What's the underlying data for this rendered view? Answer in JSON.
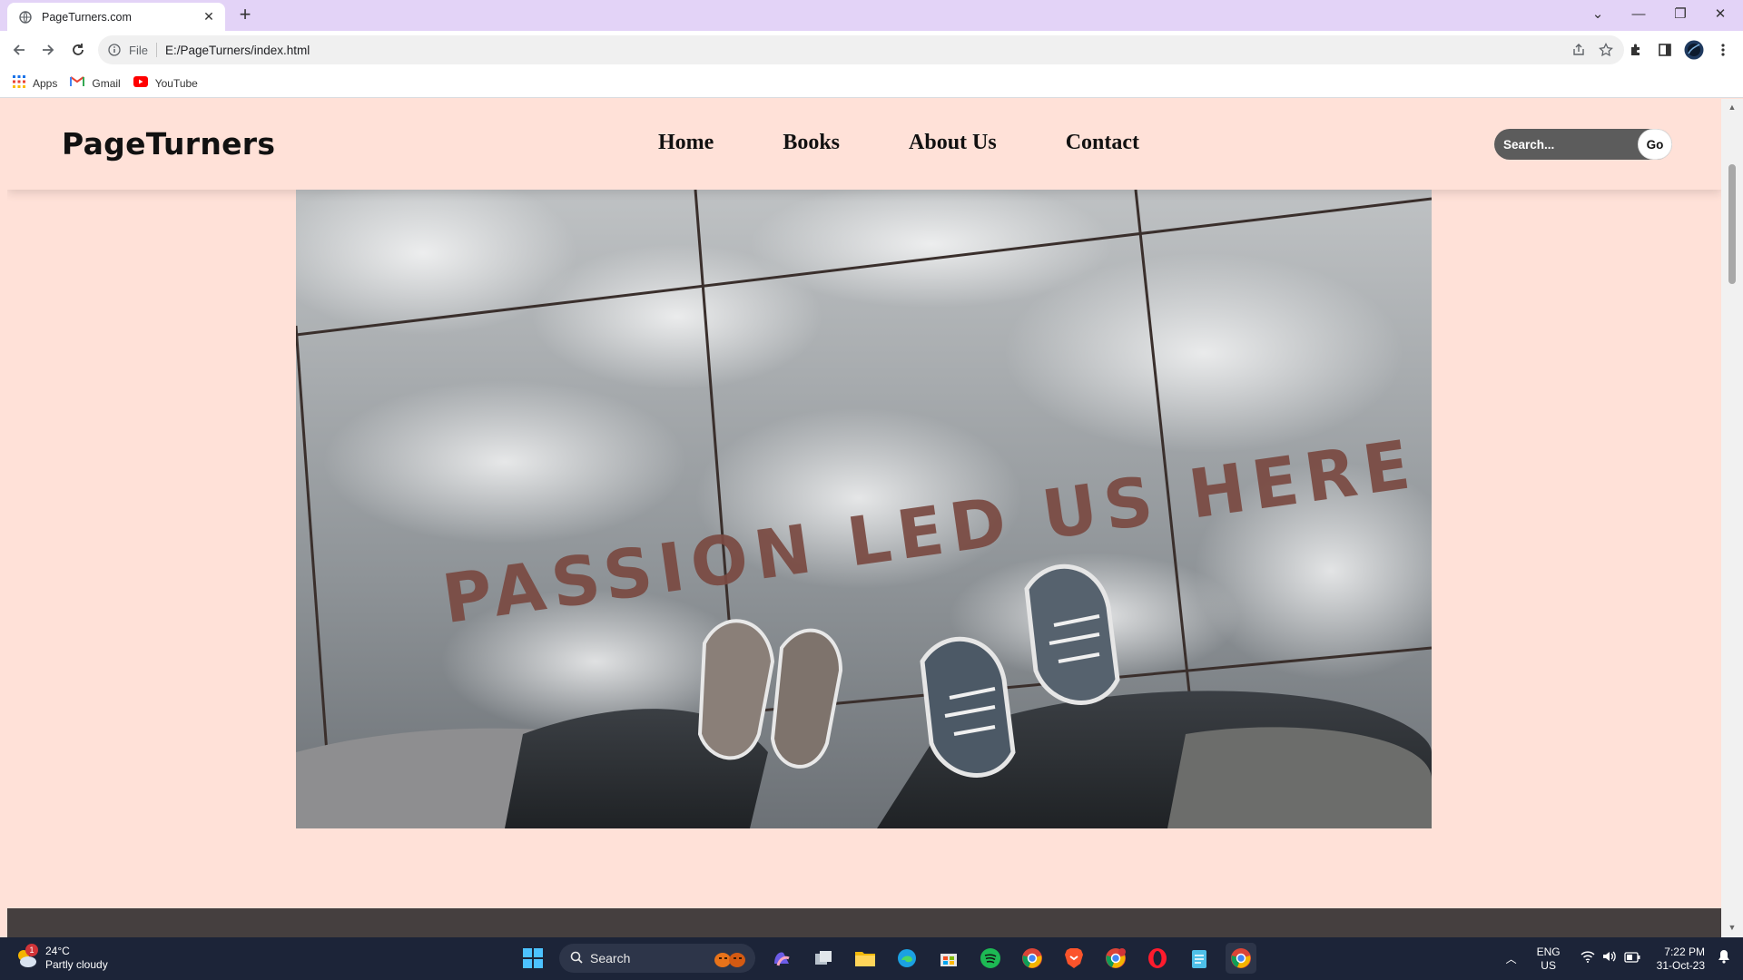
{
  "browser": {
    "tab_title": "PageTurners.com",
    "scheme_label": "File",
    "url": "E:/PageTurners/index.html",
    "bookmarks": [
      {
        "label": "Apps",
        "icon": "apps-grid-icon"
      },
      {
        "label": "Gmail",
        "icon": "gmail-icon"
      },
      {
        "label": "YouTube",
        "icon": "youtube-icon"
      }
    ]
  },
  "site": {
    "brand": "PageTurners",
    "nav": [
      "Home",
      "Books",
      "About Us",
      "Contact"
    ],
    "search": {
      "placeholder": "Search...",
      "button_label": "Go"
    },
    "hero": {
      "image_text": "PASSION LED US HERE",
      "alt": "Two pairs of shoes standing on a sidewalk with the words PASSION LED US HERE"
    }
  },
  "taskbar": {
    "weather": {
      "temp": "24°C",
      "condition": "Partly cloudy",
      "badge": "1"
    },
    "search_label": "Search",
    "lang_line1": "ENG",
    "lang_line2": "US",
    "time": "7:22 PM",
    "date": "31-Oct-23"
  },
  "colors": {
    "page_bg": "#ffe1d8",
    "footer_band": "#453f3f",
    "tab_strip": "#e3d3f7",
    "taskbar": "#1c2438"
  }
}
